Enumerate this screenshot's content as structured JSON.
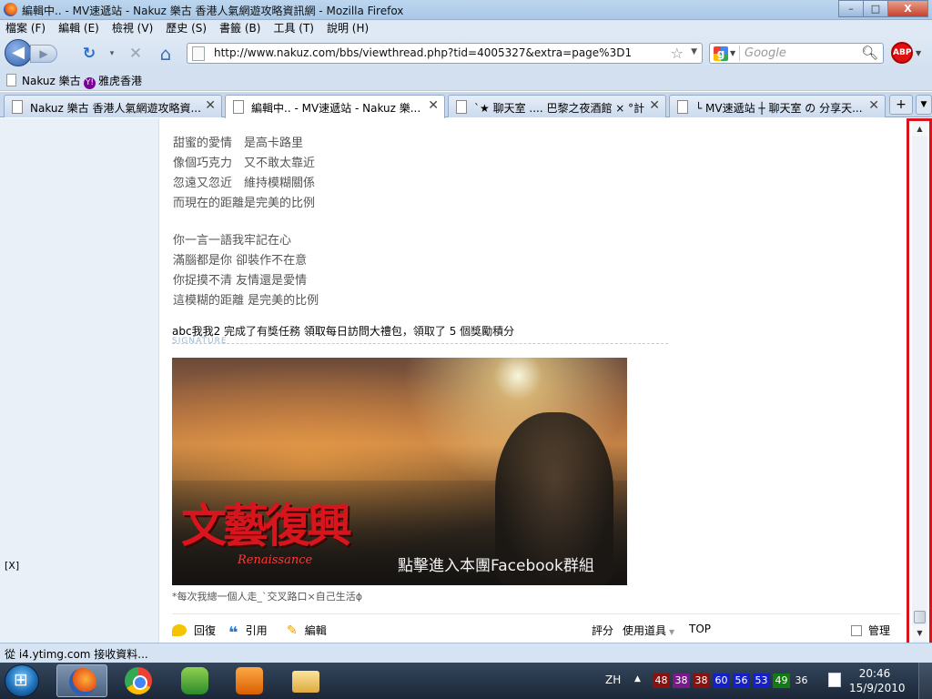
{
  "window": {
    "title": "編輯中.. - MV速遞站 - Nakuz 樂古 香港人氣網遊攻略資訊網 - Mozilla Firefox",
    "minimize": "–",
    "maximize": "□",
    "close": "X"
  },
  "menu": [
    "檔案 (F)",
    "編輯 (E)",
    "檢視 (V)",
    "歷史 (S)",
    "書籤 (B)",
    "工具 (T)",
    "說明 (H)"
  ],
  "nav": {
    "url": "http://www.nakuz.com/bbs/viewthread.php?tid=4005327&extra=page%3D1",
    "search_placeholder": "Google",
    "back_glyph": "◀",
    "forward_glyph": "▶",
    "reload_glyph": "↻",
    "stop_glyph": "✕",
    "home_glyph": "⌂",
    "star_glyph": "☆",
    "adblock_label": "ABP"
  },
  "bookmarks": [
    {
      "label": "Nakuz 樂古",
      "icon": "page-icon"
    },
    {
      "label": "雅虎香港",
      "icon": "yahoo-icon"
    }
  ],
  "tabs": [
    {
      "label": "Nakuz 樂古 香港人氣網遊攻略資...",
      "active": false
    },
    {
      "label": "編輯中.. - MV速遞站 - Nakuz 樂...",
      "active": true
    },
    {
      "label": "`★ 聊天室 .... 巴黎之夜酒館 × °計...",
      "active": false
    },
    {
      "label": "└ MV速遞站 ┼ 聊天室 の 分享天...",
      "active": false
    }
  ],
  "sidebar": {
    "close_label": "[X]"
  },
  "post": {
    "lyrics_block1": [
      "甜蜜的愛情　是高卡路里",
      "像個巧克力　又不敢太靠近",
      "忽遠又忽近　維持模糊關係",
      "而現在的距離是完美的比例"
    ],
    "lyrics_block2": [
      "你一言一語我牢記在心",
      "滿腦都是你 卻裝作不在意",
      "你捉摸不清 友情還是愛情",
      "這模糊的距離 是完美的比例"
    ],
    "task_user": "abc我我2",
    "task_text": " 完成了有獎任務 ",
    "task_name": "領取每日訪問大禮包",
    "task_reward": "，領取了 5 個獎勵積分",
    "signature_label": "SIGNATURE",
    "banner_calligraphy": "文藝復興",
    "banner_subtitle": "Renaissance",
    "banner_caption": "點擊進入本團Facebook群組",
    "signature_text": "*每次我總一個人走_`交叉路口×自己生活ɸ",
    "actions": {
      "reply": "回復",
      "quote": "引用",
      "edit": "編輯",
      "rate": "評分",
      "tools": "使用道具",
      "top": "TOP",
      "manage": "管理"
    }
  },
  "status": {
    "text": "從 i4.ytimg.com 接收資料..."
  },
  "taskbar": {
    "apps": [
      "firefox",
      "chrome",
      "messenger",
      "media-player",
      "explorer"
    ],
    "language": "ZH",
    "tray_numbers": [
      {
        "value": "48",
        "color": "#8b1010"
      },
      {
        "value": "38",
        "color": "#7a1a8a"
      },
      {
        "value": "38",
        "color": "#8b1010"
      },
      {
        "value": "60",
        "color": "#1620c8"
      },
      {
        "value": "56",
        "color": "#1620c8"
      },
      {
        "value": "53",
        "color": "#1620c8"
      },
      {
        "value": "49",
        "color": "#127a12"
      },
      {
        "value": "36",
        "color": "transparent"
      }
    ],
    "time": "20:46",
    "date": "15/9/2010"
  }
}
